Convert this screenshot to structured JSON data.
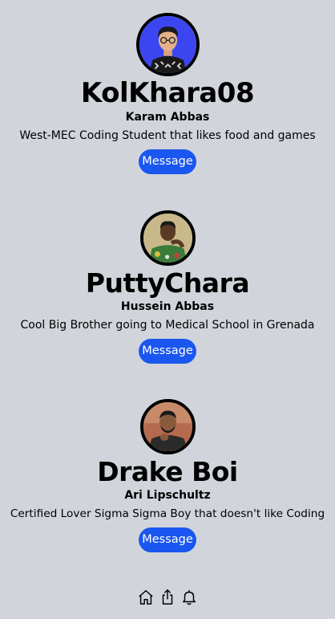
{
  "profiles": [
    {
      "username": "KolKhara08",
      "real_name": "Karam Abbas",
      "bio": "West-MEC Coding Student that likes food and games",
      "message_label": "Message",
      "avatar_bg": "#3b46f0"
    },
    {
      "username": "PuttyChara",
      "real_name": "Hussein Abbas",
      "bio": "Cool Big Brother going to Medical School in Grenada",
      "message_label": "Message",
      "avatar_bg": "#c9b98a"
    },
    {
      "username": "Drake Boi",
      "real_name": "Ari Lipschultz",
      "bio": "Certified Lover Sigma Sigma Boy that doesn't like Coding",
      "message_label": "Message",
      "avatar_bg": "#b56a4e"
    }
  ],
  "nav": {
    "icons": [
      "home-icon",
      "share-icon",
      "bell-icon"
    ]
  },
  "colors": {
    "background": "#d1d5db",
    "button": "#1a56f0",
    "button_text": "#ffffff"
  }
}
